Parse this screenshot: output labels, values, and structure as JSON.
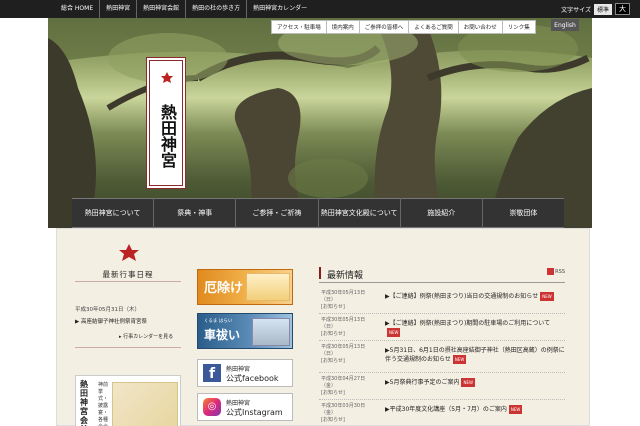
{
  "topbar": {
    "links": [
      "総合 HOME",
      "熱田神宮",
      "熱田神宮会館",
      "熱田の杜の歩き方",
      "熱田神宮カレンダー"
    ],
    "font_size_label": "文字サイズ",
    "font_std": "標準",
    "font_big": "大"
  },
  "util": {
    "links": [
      "アクセス・駐車場",
      "境内案内",
      "ご参拝の皆様へ",
      "よくあるご質問",
      "お問い合わせ",
      "リンク集"
    ],
    "english": "English"
  },
  "logo": {
    "text": "熱田神宮"
  },
  "nav": {
    "items": [
      "熱田神宮について",
      "祭典・神事",
      "ご参拝・ご祈祷",
      "熱田神宮文化殿について",
      "施設紹介",
      "崇敬団体"
    ]
  },
  "left": {
    "heading": "最新行事日程",
    "date": "平成30年05月31日（木）",
    "event": "高座結御子神社例祭宵宮祭",
    "more": "行事カレンダーを見る",
    "shop_title": "熱田神宮会館",
    "shop_sub": "神前挙式・披露宴・各種会合"
  },
  "banners": {
    "yakuyoke": "厄除け",
    "kuruma_small": "くるま はらい",
    "kuruma": "車祓い",
    "fb_line1": "熱田神宮",
    "fb_line2": "公式facebook",
    "ig_line1": "熱田神宮",
    "ig_line2": "公式Instagram"
  },
  "news": {
    "heading": "最新情報",
    "rss": "RSS",
    "new_badge": "NEW",
    "items": [
      {
        "date": "平成30年05月13日（日）",
        "cat": "[お知らせ]",
        "text": "【ご連絡】例祭(熱田まつり)当日の交通規制のお知らせ"
      },
      {
        "date": "平成30年05月13日（日）",
        "cat": "[お知らせ]",
        "text": "【ご連絡】例祭(熱田まつり)期間の駐車場のご利用について"
      },
      {
        "date": "平成30年05月13日（日）",
        "cat": "[お知らせ]",
        "text": "5月31日、6月1日の摂社高座結御子神社（熱田区高蔵）の例祭に伴う交通規制のお知らせ"
      },
      {
        "date": "平成30年04月27日（金）",
        "cat": "[お知らせ]",
        "text": "5月祭典行事予定のご案内"
      },
      {
        "date": "平成30年03月30日（金）",
        "cat": "[お知らせ]",
        "text": "平成30年度文化講座（5月・7月）のご案内"
      }
    ]
  }
}
